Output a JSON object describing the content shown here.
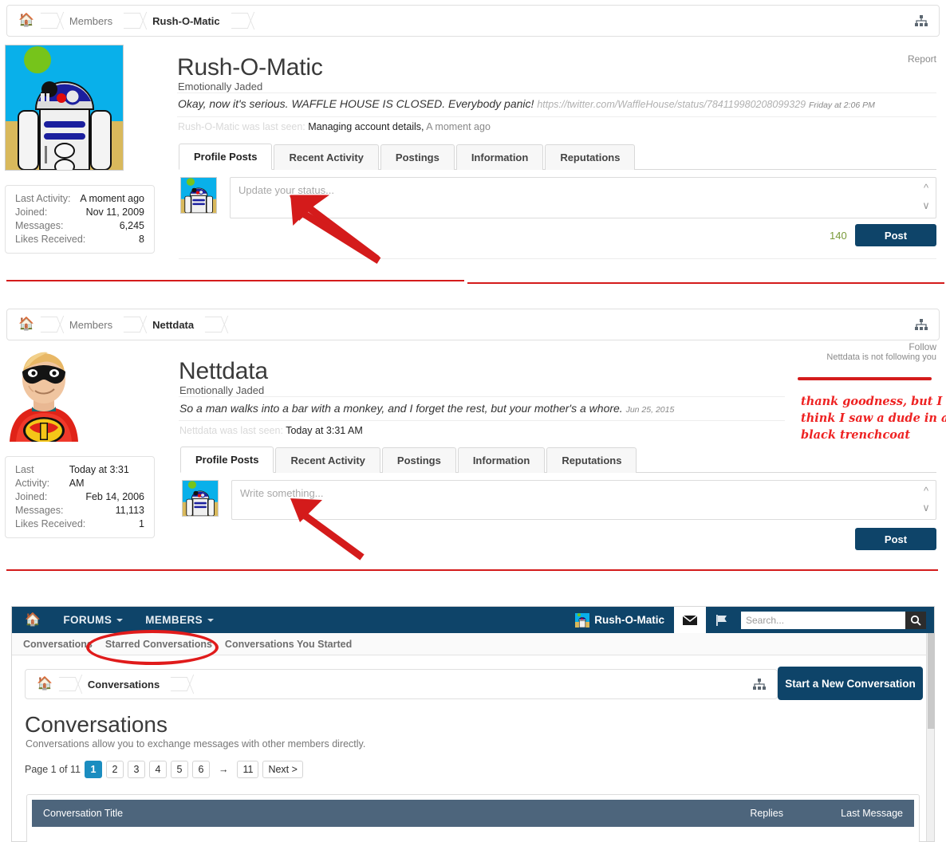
{
  "panel1": {
    "breadcrumb": {
      "home_icon": "home-icon",
      "items": [
        "Members",
        "Rush-O-Matic"
      ],
      "sitemap_icon": "sitemap-icon"
    },
    "report_label": "Report",
    "avatar_alt": "r2d2-avatar",
    "name": "Rush-O-Matic",
    "user_title": "Emotionally Jaded",
    "status_text": "Okay, now it's serious. WAFFLE HOUSE IS CLOSED. Everybody panic!",
    "status_link": "https://twitter.com/WaffleHouse/status/784119980208099329",
    "status_date": "Friday at 2:06 PM",
    "last_seen_prefix": "Rush-O-Matic was last seen:",
    "last_seen_activity": "Managing account details,",
    "last_seen_time": "A moment ago",
    "tabs": [
      {
        "label": "Profile Posts",
        "active": true
      },
      {
        "label": "Recent Activity",
        "active": false
      },
      {
        "label": "Postings",
        "active": false
      },
      {
        "label": "Information",
        "active": false
      },
      {
        "label": "Reputations",
        "active": false
      }
    ],
    "stats": [
      {
        "key": "Last Activity:",
        "value": "A moment ago"
      },
      {
        "key": "Joined:",
        "value": "Nov 11, 2009"
      },
      {
        "key": "Messages:",
        "value": "6,245"
      },
      {
        "key": "Likes Received:",
        "value": "8"
      }
    ],
    "composer_placeholder": "Update your status...",
    "char_counter": "140",
    "post_label": "Post"
  },
  "panel2": {
    "breadcrumb": {
      "home_icon": "home-icon",
      "items": [
        "Members",
        "Nettdata"
      ],
      "sitemap_icon": "sitemap-icon"
    },
    "follow_label": "Follow",
    "follow_status": "Nettdata is not following you",
    "avatar_alt": "mr-incredible-avatar",
    "name": "Nettdata",
    "user_title": "Emotionally Jaded",
    "status_text": "So a man walks into a bar with a monkey, and I forget the rest, but your mother's a whore.",
    "status_date": "Jun 25, 2015",
    "last_seen_prefix": "Nettdata was last seen:",
    "last_seen_time": "Today at 3:31 AM",
    "tabs": [
      {
        "label": "Profile Posts",
        "active": true
      },
      {
        "label": "Recent Activity",
        "active": false
      },
      {
        "label": "Postings",
        "active": false
      },
      {
        "label": "Information",
        "active": false
      },
      {
        "label": "Reputations",
        "active": false
      }
    ],
    "stats": [
      {
        "key": "Last Activity:",
        "value": "Today at 3:31 AM"
      },
      {
        "key": "Joined:",
        "value": "Feb 14, 2006"
      },
      {
        "key": "Messages:",
        "value": "11,113"
      },
      {
        "key": "Likes Received:",
        "value": "1"
      }
    ],
    "composer_placeholder": "Write something...",
    "post_label": "Post"
  },
  "panel3": {
    "nav": {
      "home_icon": "home-icon",
      "items": [
        "FORUMS",
        "MEMBERS"
      ],
      "username": "Rush-O-Matic",
      "inbox_icon": "envelope-icon",
      "alerts_icon": "flag-icon",
      "search_placeholder": "Search...",
      "search_icon": "search-icon"
    },
    "subnav": [
      "Conversations",
      "Starred Conversations",
      "Conversations You Started"
    ],
    "breadcrumb": {
      "home_icon": "home-icon",
      "items": [
        "Conversations"
      ],
      "sitemap_icon": "sitemap-icon"
    },
    "new_conversation_label": "Start a New Conversation",
    "title": "Conversations",
    "subtitle": "Conversations allow you to exchange messages with other members directly.",
    "pager": {
      "label": "Page 1 of 11",
      "pages": [
        "1",
        "2",
        "3",
        "4",
        "5",
        "6"
      ],
      "ellipsis": "→",
      "last": "11",
      "next": "Next >"
    },
    "table_headers": {
      "title": "Conversation Title",
      "replies": "Replies",
      "last_message": "Last Message"
    }
  },
  "annotations": {
    "note": "thank goodness, but I\nthink I saw a dude in a\nblack trenchcoat",
    "color": "#ee2222"
  },
  "colors": {
    "navy": "#0e4469",
    "table_header": "#4d657c",
    "page_active": "#1b8dc0",
    "annotation_red": "#d41b1b"
  }
}
